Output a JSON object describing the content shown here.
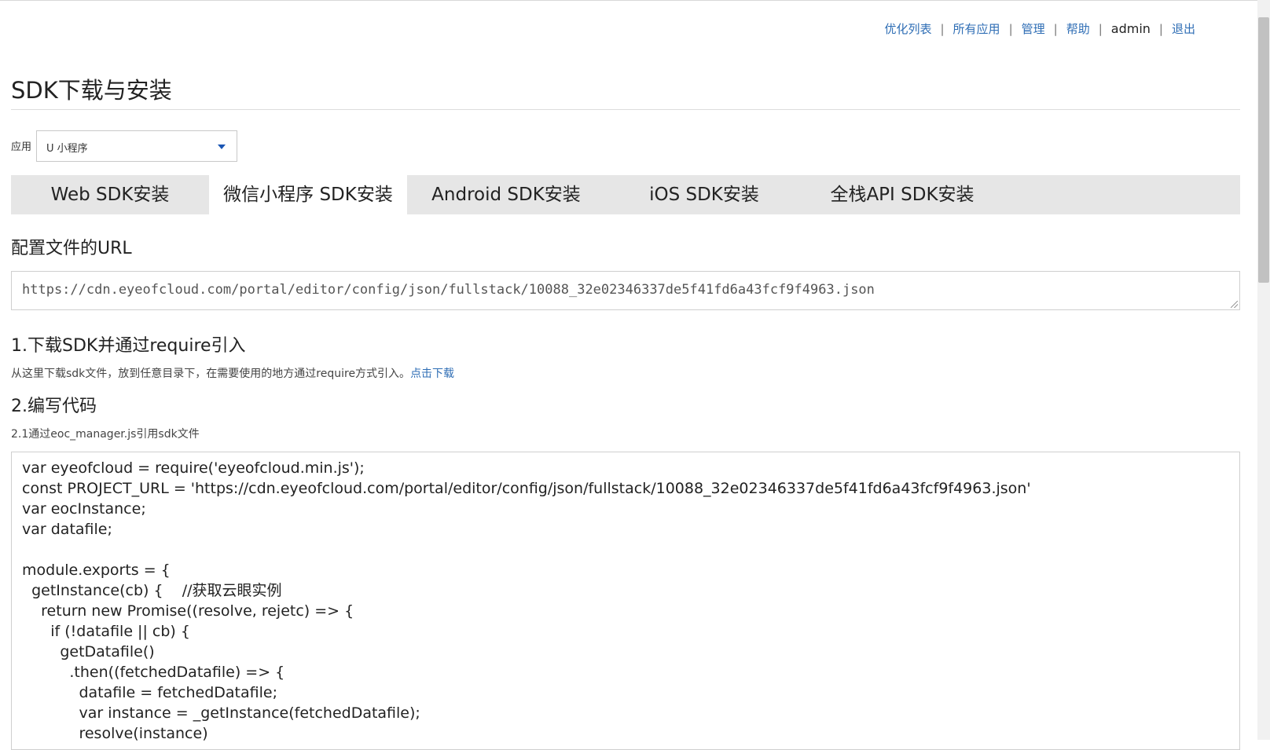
{
  "topnav": {
    "links": [
      "优化列表",
      "所有应用",
      "管理",
      "帮助"
    ],
    "user": "admin",
    "logout": "退出",
    "separator": "|"
  },
  "page_title": "SDK下载与安装",
  "app_select": {
    "label": "应用",
    "value": "U 小程序"
  },
  "tabs": [
    {
      "label": "Web SDK安装",
      "active": false
    },
    {
      "label": "微信小程序 SDK安装",
      "active": true
    },
    {
      "label": "Android SDK安装",
      "active": false
    },
    {
      "label": "iOS SDK安装",
      "active": false
    },
    {
      "label": "全栈API SDK安装",
      "active": false
    }
  ],
  "config": {
    "heading": "配置文件的URL",
    "url": "https://cdn.eyeofcloud.com/portal/editor/config/json/fullstack/10088_32e02346337de5f41fd6a43fcf9f4963.json"
  },
  "step1": {
    "heading": "1.下载SDK并通过require引入",
    "desc": "从这里下载sdk文件，放到任意目录下，在需要使用的地方通过require方式引入。",
    "link": "点击下载"
  },
  "step2": {
    "heading": "2.编写代码",
    "sub": "2.1通过eoc_manager.js引用sdk文件"
  },
  "code_lines": [
    "var eyeofcloud = require('eyeofcloud.min.js');",
    "const PROJECT_URL = 'https://cdn.eyeofcloud.com/portal/editor/config/json/fullstack/10088_32e02346337de5f41fd6a43fcf9f4963.json'",
    "var eocInstance;",
    "var datafile;",
    "",
    "module.exports = {",
    "  getInstance(cb) {    //获取云眼实例",
    "    return new Promise((resolve, rejetc) => {",
    "      if (!datafile || cb) {",
    "        getDatafile()",
    "          .then((fetchedDatafile) => {",
    "            datafile = fetchedDatafile;",
    "            var instance = _getInstance(fetchedDatafile);",
    "            resolve(instance)"
  ]
}
